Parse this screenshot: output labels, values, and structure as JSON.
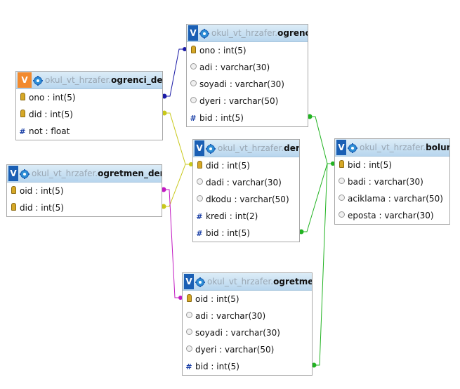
{
  "tables": {
    "ogrenci": {
      "db": "okul_vt_hrzafer.",
      "name": "ogrenci",
      "columns": [
        {
          "text": "ono : int(5)",
          "icon": "key"
        },
        {
          "text": "adi : varchar(30)",
          "icon": "string"
        },
        {
          "text": "soyadi : varchar(30)",
          "icon": "string"
        },
        {
          "text": "dyeri : varchar(50)",
          "icon": "string"
        },
        {
          "text": "bid : int(5)",
          "icon": "number"
        }
      ]
    },
    "ogrenci_ders": {
      "db": "okul_vt_hrzafer.",
      "name": "ogrenci_ders",
      "columns": [
        {
          "text": "ono : int(5)",
          "icon": "key"
        },
        {
          "text": "did : int(5)",
          "icon": "key"
        },
        {
          "text": "not : float",
          "icon": "number"
        }
      ]
    },
    "ogretmen_ders": {
      "db": "okul_vt_hrzafer.",
      "name": "ogretmen_ders",
      "columns": [
        {
          "text": "oid : int(5)",
          "icon": "key"
        },
        {
          "text": "did : int(5)",
          "icon": "key"
        }
      ]
    },
    "ders": {
      "db": "okul_vt_hrzafer.",
      "name": "ders",
      "columns": [
        {
          "text": "did : int(5)",
          "icon": "key"
        },
        {
          "text": "dadi : varchar(30)",
          "icon": "string"
        },
        {
          "text": "dkodu : varchar(50)",
          "icon": "string"
        },
        {
          "text": "kredi : int(2)",
          "icon": "number"
        },
        {
          "text": "bid : int(5)",
          "icon": "number"
        }
      ]
    },
    "bolum": {
      "db": "okul_vt_hrzafer.",
      "name": "bolum",
      "columns": [
        {
          "text": "bid : int(5)",
          "icon": "key"
        },
        {
          "text": "badi : varchar(30)",
          "icon": "string"
        },
        {
          "text": "aciklama : varchar(50)",
          "icon": "string"
        },
        {
          "text": "eposta : varchar(30)",
          "icon": "string"
        }
      ]
    },
    "ogretmen": {
      "db": "okul_vt_hrzafer.",
      "name": "ogretmen",
      "columns": [
        {
          "text": "oid : int(5)",
          "icon": "key"
        },
        {
          "text": "adi : varchar(30)",
          "icon": "string"
        },
        {
          "text": "soyadi : varchar(30)",
          "icon": "string"
        },
        {
          "text": "dyeri : varchar(50)",
          "icon": "string"
        },
        {
          "text": "bid : int(5)",
          "icon": "number"
        }
      ]
    }
  },
  "header_letter": "V",
  "relations": [
    {
      "from": "ogrenci_ders.ono",
      "to": "ogrenci.ono",
      "color": "#1a1aa6"
    },
    {
      "from": "ogrenci_ders.did",
      "to": "ders.did",
      "color": "#c8c81a"
    },
    {
      "from": "ogretmen_ders.did",
      "to": "ders.did",
      "color": "#c8c81a"
    },
    {
      "from": "ogretmen_ders.oid",
      "to": "ogretmen.oid",
      "color": "#c21ac2"
    },
    {
      "from": "ogrenci.bid",
      "to": "bolum.bid",
      "color": "#22b322"
    },
    {
      "from": "ders.bid",
      "to": "bolum.bid",
      "color": "#22b322"
    },
    {
      "from": "ogretmen.bid",
      "to": "bolum.bid",
      "color": "#22b322"
    }
  ]
}
